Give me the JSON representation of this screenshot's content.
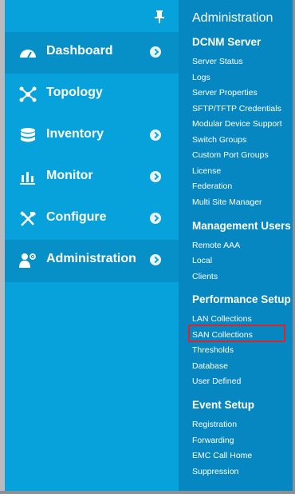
{
  "nav": {
    "items": [
      {
        "label": "Dashboard",
        "icon": "dashboard-icon",
        "has_submenu": true
      },
      {
        "label": "Topology",
        "icon": "topology-icon",
        "has_submenu": false
      },
      {
        "label": "Inventory",
        "icon": "inventory-icon",
        "has_submenu": true
      },
      {
        "label": "Monitor",
        "icon": "monitor-icon",
        "has_submenu": true
      },
      {
        "label": "Configure",
        "icon": "configure-icon",
        "has_submenu": true
      },
      {
        "label": "Administration",
        "icon": "administration-icon",
        "has_submenu": true
      }
    ],
    "active": "Administration"
  },
  "flyout": {
    "title": "Administration",
    "sections": [
      {
        "heading": "DCNM Server",
        "items": [
          "Server Status",
          "Logs",
          "Server Properties",
          "SFTP/TFTP Credentials",
          "Modular Device Support",
          "Switch Groups",
          "Custom Port Groups",
          "License",
          "Federation",
          "Multi Site Manager"
        ]
      },
      {
        "heading": "Management Users",
        "items": [
          "Remote AAA",
          "Local",
          "Clients"
        ]
      },
      {
        "heading": "Performance Setup",
        "items": [
          "LAN Collections",
          "SAN Collections",
          "Thresholds",
          "Database",
          "User Defined"
        ]
      },
      {
        "heading": "Event Setup",
        "items": [
          "Registration",
          "Forwarding",
          "EMC Call Home",
          "Suppression"
        ]
      }
    ],
    "highlighted_item": "SAN Collections"
  },
  "colors": {
    "nav_bg": "#07a1dc",
    "nav_active_bg": "#0790c7",
    "flyout_bg": "#0787c2",
    "highlight": "#d9262c"
  }
}
